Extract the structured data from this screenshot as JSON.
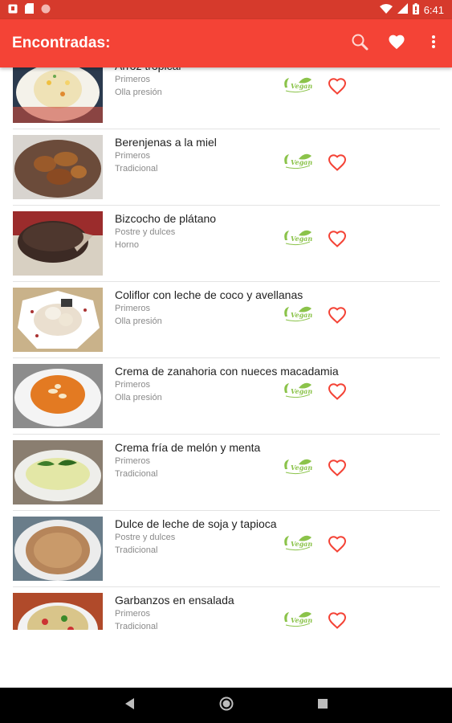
{
  "status_bar": {
    "time": "6:41",
    "icons": [
      "notification-icon",
      "sd-card-icon",
      "circle-icon",
      "wifi-icon",
      "signal-icon",
      "battery-icon"
    ]
  },
  "app_bar": {
    "title": "Encontradas:",
    "actions": [
      "search-icon",
      "heart-icon",
      "more-vert-icon"
    ]
  },
  "colors": {
    "primary": "#f44336",
    "primary_dark": "#d63a2c",
    "heart": "#f44336",
    "vegan": "#8bc34a"
  },
  "recipes": [
    {
      "name": "Arroz tropical",
      "category": "Primeros",
      "method": "Olla presión",
      "badge": "Vegan"
    },
    {
      "name": "Berenjenas a la miel",
      "category": "Primeros",
      "method": "Tradicional",
      "badge": "Vegan"
    },
    {
      "name": "Bizcocho de plátano",
      "category": "Postre y dulces",
      "method": "Horno",
      "badge": "Vegan"
    },
    {
      "name": "Coliflor con leche de coco y avellanas",
      "category": "Primeros",
      "method": "Olla presión",
      "badge": "Vegan"
    },
    {
      "name": "Crema de zanahoria con nueces macadamia",
      "category": "Primeros",
      "method": "Olla presión",
      "badge": "Vegan"
    },
    {
      "name": "Crema fría de melón y menta",
      "category": "Primeros",
      "method": "Tradicional",
      "badge": "Vegan"
    },
    {
      "name": "Dulce de leche de soja y tapioca",
      "category": "Postre y dulces",
      "method": "Tradicional",
      "badge": "Vegan"
    },
    {
      "name": "Garbanzos en ensalada",
      "category": "Primeros",
      "method": "Tradicional",
      "badge": "Vegan"
    }
  ],
  "nav_bar": {
    "buttons": [
      "back-icon",
      "home-icon",
      "recents-icon"
    ]
  }
}
